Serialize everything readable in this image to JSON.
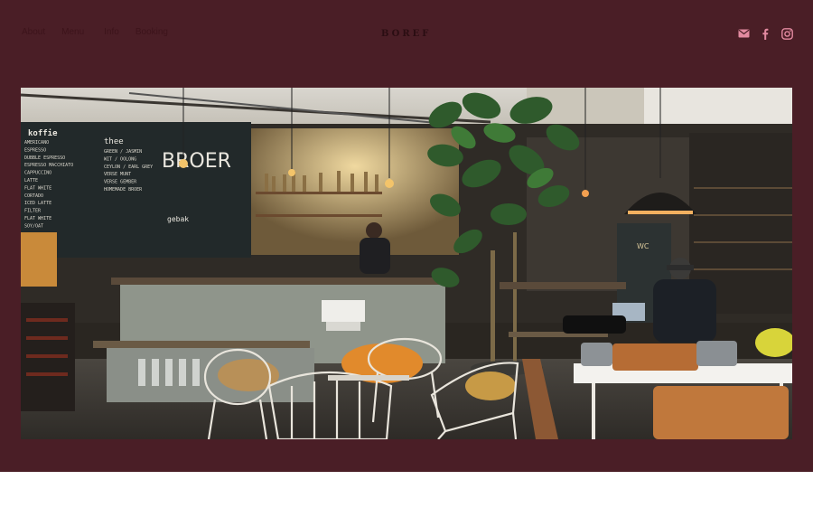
{
  "nav": {
    "items": [
      {
        "label": "About"
      },
      {
        "label": "Menu"
      },
      {
        "label": "Info"
      },
      {
        "label": "Booking"
      }
    ]
  },
  "brand": {
    "logo_text": "BOREF"
  },
  "social": [
    {
      "icon": "mail-icon"
    },
    {
      "icon": "facebook-icon"
    },
    {
      "icon": "instagram-icon"
    }
  ],
  "hero": {
    "chalkboard": {
      "heading_left": "koffie",
      "heading_mid": "thee",
      "brand_big": "BROER",
      "menu_lines_left": [
        "AMERICANO",
        "ESPRESSO",
        "DUBBLE ESPRESSO",
        "ESPRESSO MACCHIATO",
        "CAPPUCCINO",
        "LATTE",
        "FLAT WHITE",
        "CORTADO",
        "ICED LATTE",
        "FILTER",
        "FLAT WHITE",
        "SOY/OAT"
      ],
      "menu_lines_mid": [
        "GREEN / JASMIN",
        "WIT / OOLONG",
        "CEYLON / EARL GREY",
        "VERSE MUNT",
        "VERSE GEMBER",
        "HOMEMADE BROER"
      ],
      "note_mid": "gebak"
    },
    "sign_letters": "WC"
  },
  "colors": {
    "site_bg": "#4a1e26",
    "nav_text": "#3a1219",
    "icon_pink": "#e38aa0"
  }
}
